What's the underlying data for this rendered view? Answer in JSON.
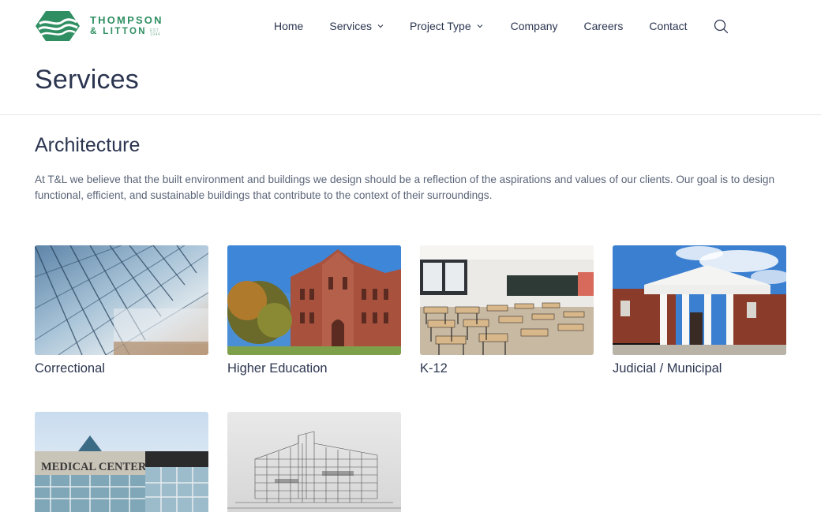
{
  "brand": {
    "line1": "THOMPSON",
    "line2": "& LITTON",
    "est": "EST. 1944",
    "colors": {
      "green": "#2f8f62",
      "navy": "#2b3550"
    }
  },
  "nav": {
    "home": "Home",
    "services": "Services",
    "project_type": "Project Type",
    "company": "Company",
    "careers": "Careers",
    "contact": "Contact",
    "search_icon": "search-icon"
  },
  "page": {
    "title": "Services"
  },
  "section": {
    "title": "Architecture",
    "description": "At T&L we believe that the built environment and buildings we design should be a reflection of the aspirations and values of our clients. Our goal is to design functional, efficient, and sustainable buildings that contribute to the context of their surroundings."
  },
  "cards": [
    {
      "label": "Correctional"
    },
    {
      "label": "Higher Education"
    },
    {
      "label": "K-12"
    },
    {
      "label": "Judicial / Municipal"
    },
    {
      "label": ""
    },
    {
      "label": ""
    }
  ],
  "images": {
    "medical_sign": "MEDICAL CENTER"
  }
}
